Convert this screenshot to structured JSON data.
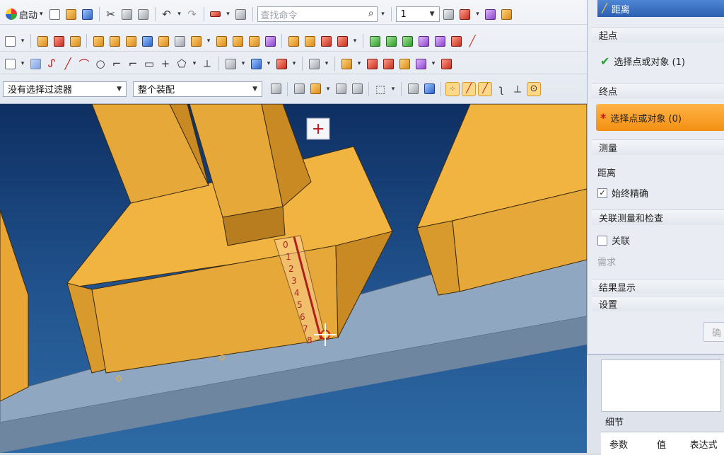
{
  "toolbar": {
    "start_label": "启动",
    "search_placeholder": "查找命令",
    "quantity_value": "1",
    "filter_value": "没有选择过滤器",
    "scope_value": "整个装配"
  },
  "panel": {
    "title": "距离",
    "start_section": "起点",
    "start_select": "选择点或对象 (1)",
    "end_section": "终点",
    "end_select": "选择点或对象 (0)",
    "measure_section": "测量",
    "distance_label": "距离",
    "always_precise_label": "始终精确",
    "assoc_section": "关联测量和检查",
    "assoc_label": "关联",
    "require_label": "需求",
    "result_section": "结果显示",
    "settings_section": "设置",
    "ok_label": "确"
  },
  "details": {
    "title": "细节",
    "columns": [
      "参数",
      "值",
      "表达式"
    ]
  },
  "ruler": {
    "ticks": [
      "0",
      "1",
      "2",
      "3",
      "4",
      "5",
      "6",
      "7",
      "8"
    ]
  },
  "colors": {
    "part": "#f2b441",
    "rail": "#9bb0c6",
    "accent_orange": "#f39013",
    "title_blue": "#2c5fb0"
  }
}
